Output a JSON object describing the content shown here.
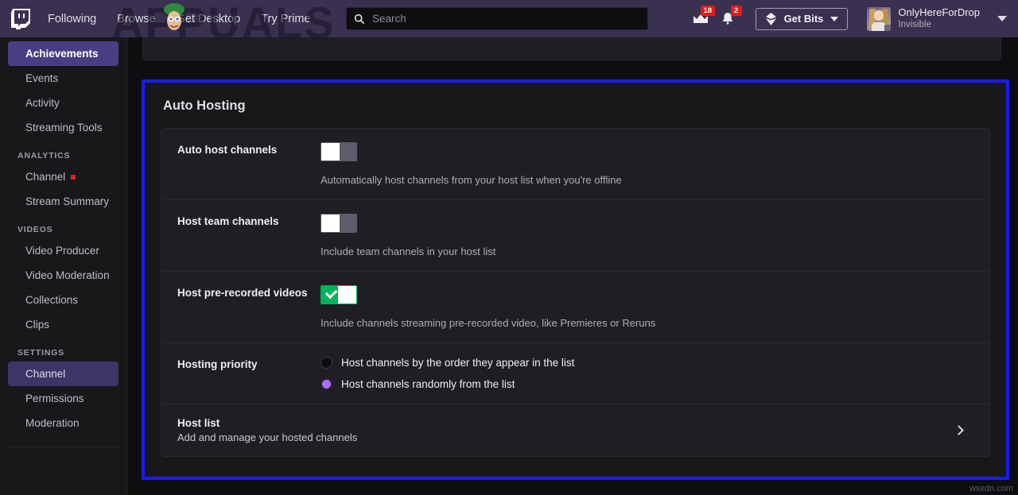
{
  "header": {
    "logo_icon": "twitch-logo-icon",
    "nav": [
      {
        "label": "Following"
      },
      {
        "label": "Browse"
      },
      {
        "label": "Get Desktop"
      },
      {
        "label": "Try Prime"
      }
    ],
    "more_label": "•••",
    "search": {
      "icon": "search-icon",
      "placeholder": "Search",
      "value": ""
    },
    "prime_icon": "crown-icon",
    "prime_badge": "18",
    "notifications_icon": "bell-icon",
    "notifications_badge": "2",
    "bits": {
      "icon": "bits-diamond-icon",
      "label": "Get Bits",
      "caret_icon": "caret-down-icon"
    },
    "user": {
      "avatar_icon": "user-avatar",
      "name": "OnlyHereForDrop",
      "status": "Invisible",
      "caret_icon": "caret-down-icon"
    }
  },
  "watermarks": {
    "overlay": "APPUALS",
    "bottom_right": "wsxdn.com"
  },
  "sidebar": {
    "items": [
      {
        "label": "Achievements",
        "state": "active"
      },
      {
        "label": "Events",
        "state": "normal"
      },
      {
        "label": "Activity",
        "state": "normal"
      },
      {
        "label": "Streaming Tools",
        "state": "normal"
      }
    ],
    "sections": [
      {
        "heading": "ANALYTICS",
        "items": [
          {
            "label": "Channel",
            "badge": true
          },
          {
            "label": "Stream Summary",
            "badge": false
          }
        ]
      },
      {
        "heading": "VIDEOS",
        "items": [
          {
            "label": "Video Producer",
            "badge": false
          },
          {
            "label": "Video Moderation",
            "badge": false
          },
          {
            "label": "Collections",
            "badge": false
          },
          {
            "label": "Clips",
            "badge": false
          }
        ]
      },
      {
        "heading": "SETTINGS",
        "items": [
          {
            "label": "Channel",
            "badge": false,
            "state": "selected"
          },
          {
            "label": "Permissions",
            "badge": false
          },
          {
            "label": "Moderation",
            "badge": false
          }
        ]
      }
    ]
  },
  "main": {
    "panel_title": "Auto Hosting",
    "rows": [
      {
        "label": "Auto host channels",
        "toggle_state": "off",
        "description": "Automatically host channels from your host list when you're offline"
      },
      {
        "label": "Host team channels",
        "toggle_state": "off",
        "description": "Include team channels in your host list"
      },
      {
        "label": "Host pre-recorded videos",
        "toggle_state": "on",
        "description": "Include channels streaming pre-recorded video, like Premieres or Reruns"
      }
    ],
    "priority": {
      "label": "Hosting priority",
      "options": [
        {
          "label": "Host channels by the order they appear in the list",
          "selected": false
        },
        {
          "label": "Host channels randomly from the list",
          "selected": true
        }
      ]
    },
    "host_list": {
      "title": "Host list",
      "subtitle": "Add and manage your hosted channels",
      "chevron_icon": "chevron-right-icon"
    }
  },
  "colors": {
    "twitch_purple": "#9147ff",
    "header_bg": "#3a3150",
    "toggle_on": "#00b35a",
    "radio_selected": "#a970ff",
    "badge_red": "#e91916",
    "annotation_blue": "#1a1aff"
  }
}
